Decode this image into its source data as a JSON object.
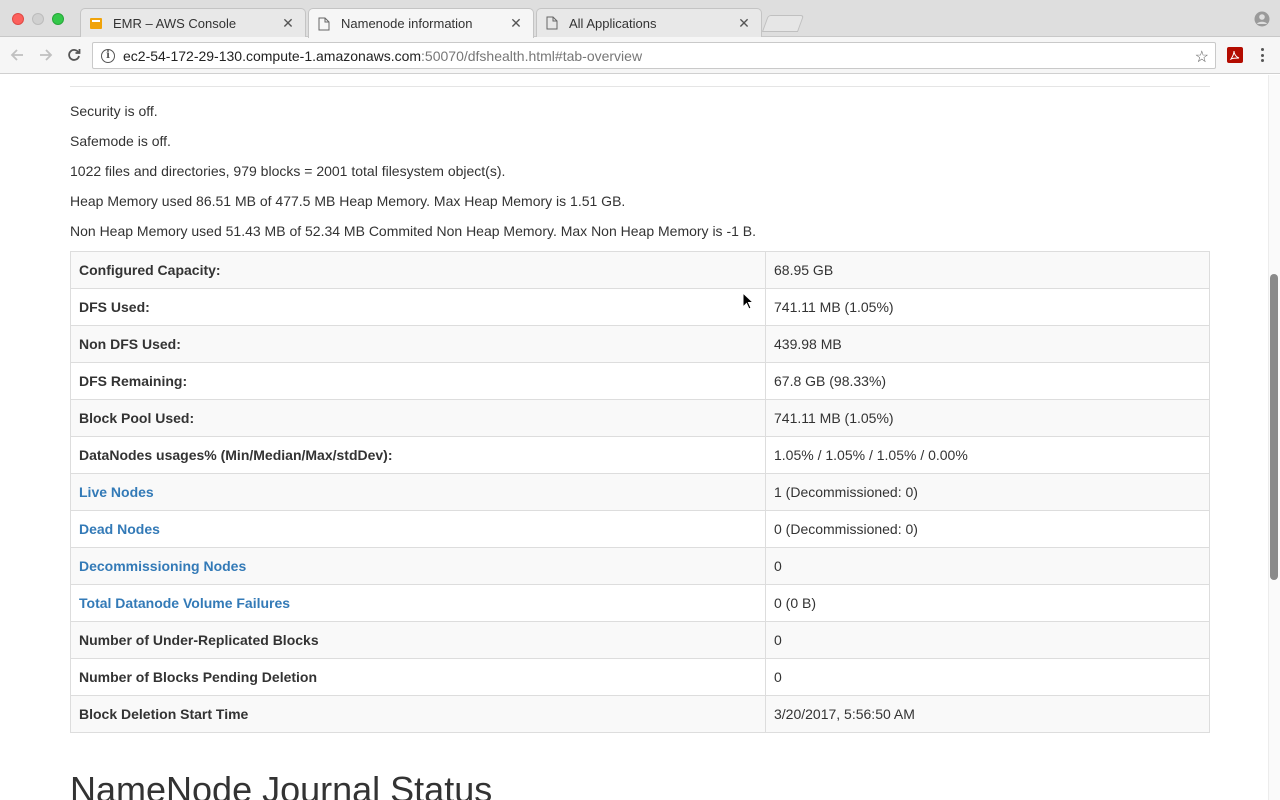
{
  "tabs": [
    {
      "label": "EMR – AWS Console",
      "icon": "aws-icon",
      "active": false
    },
    {
      "label": "Namenode information",
      "icon": "page-icon",
      "active": true
    },
    {
      "label": "All Applications",
      "icon": "page-icon",
      "active": false
    }
  ],
  "address_bar": {
    "host": "ec2-54-172-29-130.compute-1.amazonaws.com",
    "path": ":50070/dfshealth.html#tab-overview"
  },
  "info_lines": [
    "Security is off.",
    "Safemode is off.",
    "1022 files and directories, 979 blocks = 2001 total filesystem object(s).",
    "Heap Memory used 86.51 MB of 477.5 MB Heap Memory. Max Heap Memory is 1.51 GB.",
    "Non Heap Memory used 51.43 MB of 52.34 MB Commited Non Heap Memory. Max Non Heap Memory is -1 B."
  ],
  "summary": [
    {
      "key": "Configured Capacity:",
      "value": "68.95 GB",
      "link": false
    },
    {
      "key": "DFS Used:",
      "value": "741.11 MB (1.05%)",
      "link": false
    },
    {
      "key": "Non DFS Used:",
      "value": "439.98 MB",
      "link": false
    },
    {
      "key": "DFS Remaining:",
      "value": "67.8 GB (98.33%)",
      "link": false
    },
    {
      "key": "Block Pool Used:",
      "value": "741.11 MB (1.05%)",
      "link": false
    },
    {
      "key": "DataNodes usages% (Min/Median/Max/stdDev):",
      "value": "1.05% / 1.05% / 1.05% / 0.00%",
      "link": false
    },
    {
      "key": "Live Nodes",
      "value": "1 (Decommissioned: 0)",
      "link": true
    },
    {
      "key": "Dead Nodes",
      "value": "0 (Decommissioned: 0)",
      "link": true
    },
    {
      "key": "Decommissioning Nodes",
      "value": "0",
      "link": true
    },
    {
      "key": "Total Datanode Volume Failures",
      "value": "0 (0 B)",
      "link": true
    },
    {
      "key": "Number of Under-Replicated Blocks",
      "value": "0",
      "link": false
    },
    {
      "key": "Number of Blocks Pending Deletion",
      "value": "0",
      "link": false
    },
    {
      "key": "Block Deletion Start Time",
      "value": "3/20/2017, 5:56:50 AM",
      "link": false
    }
  ],
  "journal_heading": "NameNode Journal Status",
  "colors": {
    "link": "#337ab7",
    "text": "#333333"
  }
}
